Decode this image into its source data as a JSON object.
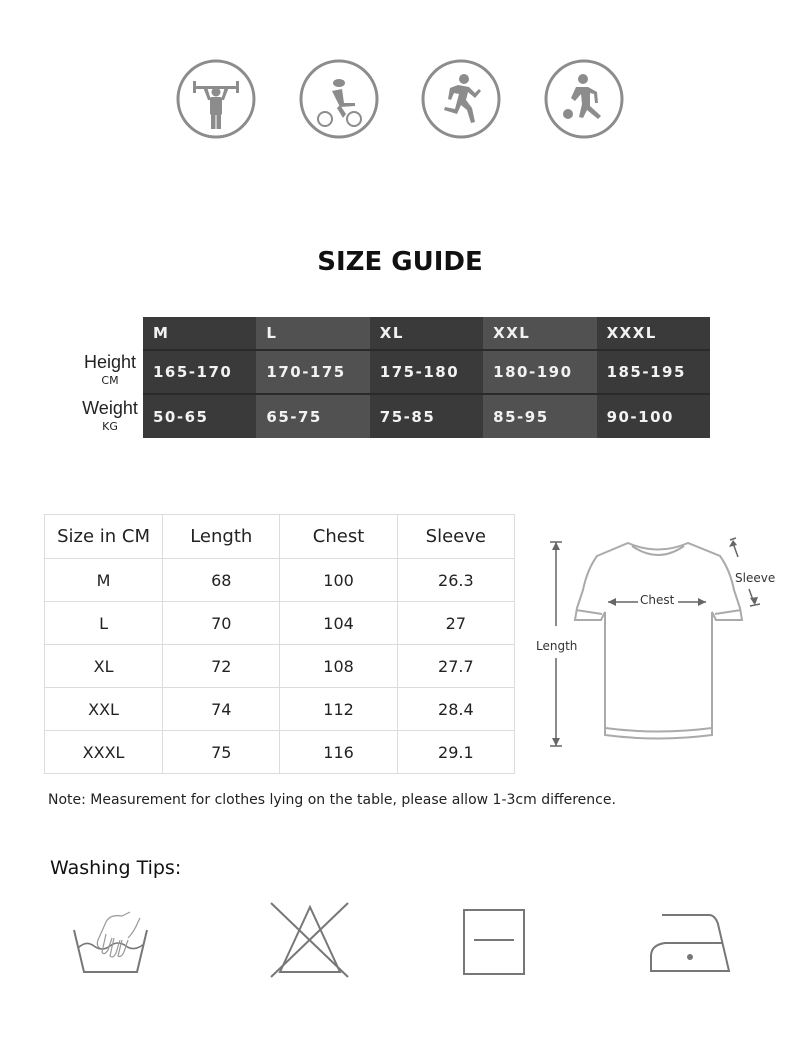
{
  "activities": [
    {
      "icon": "weightlifting-icon",
      "label": "Weightlifting"
    },
    {
      "icon": "cycling-icon",
      "label": "Cycling"
    },
    {
      "icon": "running-icon",
      "label": "Running"
    },
    {
      "icon": "basketball-icon",
      "label": "Basketball"
    }
  ],
  "size_guide": {
    "title": "SIZE GUIDE",
    "row_labels": {
      "height": {
        "main": "Height",
        "unit": "CM"
      },
      "weight": {
        "main": "Weight",
        "unit": "KG"
      }
    },
    "sizes": [
      "M",
      "L",
      "XL",
      "XXL",
      "XXXL"
    ],
    "height_cm": [
      "165-170",
      "170-175",
      "175-180",
      "180-190",
      "185-195"
    ],
    "weight_kg": [
      "50-65",
      "65-75",
      "75-85",
      "85-95",
      "90-100"
    ]
  },
  "measurements": {
    "headers": [
      "Size in CM",
      "Length",
      "Chest",
      "Sleeve"
    ],
    "rows": [
      [
        "M",
        "68",
        "100",
        "26.3"
      ],
      [
        "L",
        "70",
        "104",
        "27"
      ],
      [
        "XL",
        "72",
        "108",
        "27.7"
      ],
      [
        "XXL",
        "74",
        "112",
        "28.4"
      ],
      [
        "XXXL",
        "75",
        "116",
        "29.1"
      ]
    ]
  },
  "diagram": {
    "length_label": "Length",
    "chest_label": "Chest",
    "sleeve_label": "Sleeve"
  },
  "note": "Note: Measurement for clothes lying on the table, please allow 1-3cm difference.",
  "washing": {
    "title": "Washing Tips:",
    "icons": [
      {
        "icon": "hand-wash-icon",
        "meaning": "Hand wash"
      },
      {
        "icon": "do-not-bleach-icon",
        "meaning": "Do not bleach"
      },
      {
        "icon": "dry-flat-icon",
        "meaning": "Dry flat"
      },
      {
        "icon": "iron-low-icon",
        "meaning": "Iron low heat"
      }
    ]
  },
  "colors": {
    "icon_gray": "#8c8c8c",
    "table_dark": "#3a3a3a",
    "table_light": "#515151",
    "grid_border": "#dcdcdc"
  }
}
